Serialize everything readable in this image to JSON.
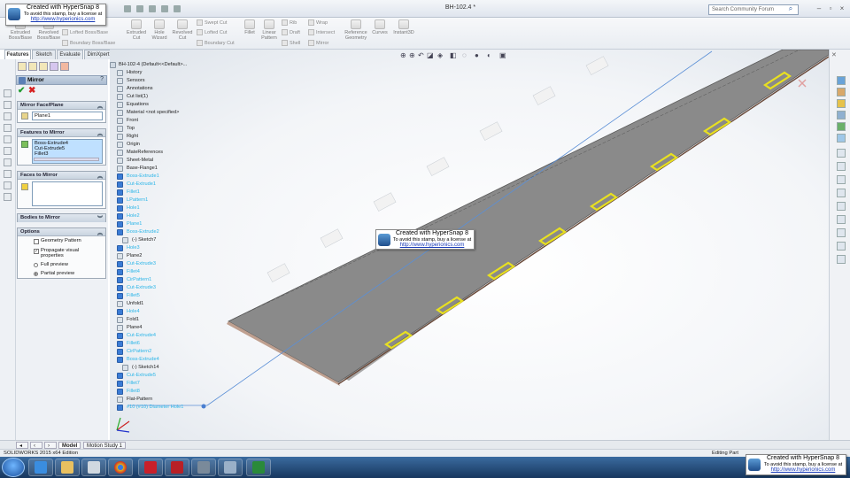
{
  "window": {
    "doc_title": "BH-102.4 *",
    "search_placeholder": "Search Community Forum"
  },
  "ribbon": {
    "buttons": [
      {
        "label": "Extruded\nBoss/Base"
      },
      {
        "label": "Revolved\nBoss/Base"
      },
      {
        "label": "Extruded\nCut"
      },
      {
        "label": "Hole\nWizard"
      },
      {
        "label": "Revolved\nCut"
      },
      {
        "label": "Fillet"
      },
      {
        "label": "Linear\nPattern"
      },
      {
        "label": "Reference\nGeometry"
      },
      {
        "label": "Curves"
      },
      {
        "label": "Instant3D"
      }
    ],
    "small": [
      "Lofted Boss/Base",
      "Boundary Boss/Base",
      "Swept Cut",
      "Lofted Cut",
      "Boundary Cut",
      "Rib",
      "Draft",
      "Shell",
      "Wrap",
      "Intersect",
      "Mirror"
    ]
  },
  "stamp": {
    "title": "Created with HyperSnap 8",
    "sub": "To avoid this stamp, buy a license at",
    "link": "http://www.hyperionics.com"
  },
  "tabs": [
    "Features",
    "Sketch",
    "Evaluate",
    "DimXpert"
  ],
  "pm": {
    "title": "Mirror",
    "mirror_face_header": "Mirror Face/Plane",
    "mirror_face_value": "Plane1",
    "features_header": "Features to Mirror",
    "features": [
      "Boss-Extrude4",
      "Cut-Extrude5",
      "Fillet3"
    ],
    "faces_header": "Faces to Mirror",
    "bodies_header": "Bodies to Mirror",
    "options_header": "Options",
    "opt_geometry_pattern": "Geometry Pattern",
    "opt_propagate": "Propagate visual properties",
    "opt_full": "Full preview",
    "opt_partial": "Partial preview"
  },
  "tree": {
    "root": "BH-102-4 (Default<<Default>...",
    "items": [
      {
        "label": "History",
        "hl": false
      },
      {
        "label": "Sensors",
        "hl": false
      },
      {
        "label": "Annotations",
        "hl": false
      },
      {
        "label": "Cut list(1)",
        "hl": false
      },
      {
        "label": "Equations",
        "hl": false
      },
      {
        "label": "Material <not specified>",
        "hl": false
      },
      {
        "label": "Front",
        "hl": false
      },
      {
        "label": "Top",
        "hl": false
      },
      {
        "label": "Right",
        "hl": false
      },
      {
        "label": "Origin",
        "hl": false
      },
      {
        "label": "MateReferences",
        "hl": false
      },
      {
        "label": "Sheet-Metal",
        "hl": false
      },
      {
        "label": "Base-Flange1",
        "hl": false
      },
      {
        "label": "Boss-Extrude1",
        "hl": true
      },
      {
        "label": "Cut-Extrude1",
        "hl": true
      },
      {
        "label": "Fillet1",
        "hl": true
      },
      {
        "label": "LPattern1",
        "hl": true
      },
      {
        "label": "Hole1",
        "hl": true
      },
      {
        "label": "Hole2",
        "hl": true
      },
      {
        "label": "Plane1",
        "hl": true
      },
      {
        "label": "Boss-Extrude2",
        "hl": true
      },
      {
        "label": "(-) Sketch7",
        "hl": false,
        "indent": true
      },
      {
        "label": "Hole3",
        "hl": true
      },
      {
        "label": "Plane2",
        "hl": false
      },
      {
        "label": "Cut-Extrude3",
        "hl": true
      },
      {
        "label": "Fillet4",
        "hl": true
      },
      {
        "label": "CirPattern1",
        "hl": true
      },
      {
        "label": "Cut-Extrude3",
        "hl": true
      },
      {
        "label": "Fillet5",
        "hl": true
      },
      {
        "label": "Unfold1",
        "hl": false
      },
      {
        "label": "Hole4",
        "hl": true
      },
      {
        "label": "Fold1",
        "hl": false
      },
      {
        "label": "Plane4",
        "hl": false
      },
      {
        "label": "Cut-Extrude4",
        "hl": true
      },
      {
        "label": "Fillet6",
        "hl": true
      },
      {
        "label": "CirPattern2",
        "hl": true
      },
      {
        "label": "Boss-Extrude4",
        "hl": true
      },
      {
        "label": "(-) Sketch14",
        "hl": false,
        "indent": true
      },
      {
        "label": "Cut-Extrude5",
        "hl": true
      },
      {
        "label": "Fillet7",
        "hl": true
      },
      {
        "label": "Fillet8",
        "hl": true
      },
      {
        "label": "Flat-Pattern",
        "hl": false
      },
      {
        "label": "#10 (#10) Diameter Hole1",
        "hl": true
      }
    ]
  },
  "bottom": {
    "tab_model": "Model",
    "tab_motion": "Motion Study 1",
    "status_left": "SOLIDWORKS 2015 x64 Edition",
    "status_right": "Editing Part"
  },
  "colors": {
    "accent": "#2ab5e8",
    "plate": "#8a8a8a",
    "highlight": "#e8e020"
  }
}
